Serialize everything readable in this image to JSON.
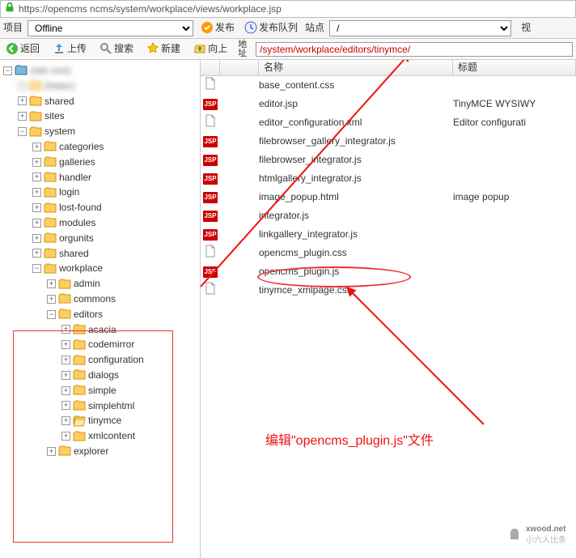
{
  "url_bar": {
    "url": "https://opencms                ncms/system/workplace/views/workplace.jsp"
  },
  "topbar": {
    "project_label": "项目",
    "project_value": "Offline",
    "publish": "发布",
    "publish_queue": "发布队列",
    "site_label": "站点",
    "site_value": "/",
    "view_label": "视"
  },
  "toolbar": {
    "back": "返回",
    "upload": "上传",
    "search": "搜索",
    "new": "新建",
    "up": "向上",
    "addr_label": "地址",
    "addr_value": "/system/workplace/editors/tinymce/"
  },
  "tree": {
    "root_blur": [
      "(site root)",
      "(folder)"
    ],
    "shared": "shared",
    "sites": "sites",
    "system": "system",
    "system_children": [
      "categories",
      "galleries",
      "handler",
      "login",
      "lost-found",
      "modules",
      "orgunits",
      "shared"
    ],
    "workplace": "workplace",
    "workplace_children_pre": [
      "admin",
      "commons"
    ],
    "editors": "editors",
    "editors_children": [
      "acacia",
      "codemirror",
      "configuration",
      "dialogs",
      "simple",
      "simplehtml",
      "tinymce",
      "xmlcontent"
    ],
    "workplace_children_post": [
      "explorer"
    ]
  },
  "list": {
    "header_name": "名称",
    "header_title": "标题",
    "files": [
      {
        "type": "file",
        "name": "base_content.css",
        "title": ""
      },
      {
        "type": "jsp",
        "name": "editor.jsp",
        "title": "TinyMCE WYSIWY"
      },
      {
        "type": "file",
        "name": "editor_configuration.xml",
        "title": "Editor configurati"
      },
      {
        "type": "jsp",
        "name": "filebrowser_gallery_integrator.js",
        "title": ""
      },
      {
        "type": "jsp",
        "name": "filebrowser_integrator.js",
        "title": ""
      },
      {
        "type": "jsp",
        "name": "htmlgallery_integrator.js",
        "title": ""
      },
      {
        "type": "jsp",
        "name": "image_popup.html",
        "title": "image popup"
      },
      {
        "type": "jsp",
        "name": "integrator.js",
        "title": ""
      },
      {
        "type": "jsp",
        "name": "linkgallery_integrator.js",
        "title": ""
      },
      {
        "type": "file",
        "name": "opencms_plugin.css",
        "title": ""
      },
      {
        "type": "jsp",
        "name": "opencms_plugin.js",
        "title": ""
      },
      {
        "type": "file",
        "name": "tinymce_xmlpage.css",
        "title": ""
      }
    ]
  },
  "annotation": {
    "text": "编辑\"opencms_plugin.js\"文件"
  },
  "watermark": {
    "text1": "xwood.net",
    "text2": "小六人比条"
  }
}
